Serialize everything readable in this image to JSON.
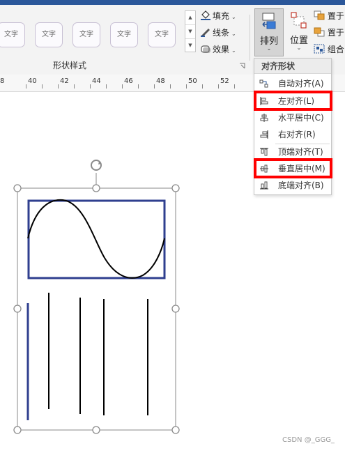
{
  "ribbon": {
    "gallery": {
      "swatch_labels": [
        "文字",
        "文字",
        "文字",
        "文字",
        "文字"
      ],
      "scroll_symbols": [
        "▲",
        "▼",
        "▼"
      ]
    },
    "format_buttons": [
      {
        "label": "填充",
        "icon": "fill-bucket-icon"
      },
      {
        "label": "线条",
        "icon": "pen-line-icon"
      },
      {
        "label": "效果",
        "icon": "effects-icon"
      }
    ],
    "group_label": "形状样式",
    "dropdown_mark": "⌄",
    "arrange": {
      "label": "排列",
      "icon": "arrange-icon"
    },
    "position": {
      "label": "位置",
      "icon": "position-icon"
    },
    "side_buttons": [
      {
        "label": "置于",
        "icon": "bring-front-icon"
      },
      {
        "label": "置于",
        "icon": "send-back-icon"
      },
      {
        "label": "组合",
        "icon": "group-icon"
      }
    ]
  },
  "ruler": {
    "numbers": [
      "8",
      "40",
      "42",
      "44",
      "46",
      "48",
      "50",
      "52"
    ]
  },
  "menu": {
    "title": "对齐形状",
    "items": [
      {
        "label": "自动对齐(A)",
        "icon": "auto-align-icon",
        "highlighted": false
      },
      {
        "label": "左对齐(L)",
        "icon": "align-left-icon",
        "highlighted": true
      },
      {
        "label": "水平居中(C)",
        "icon": "align-center-icon",
        "highlighted": false
      },
      {
        "label": "右对齐(R)",
        "icon": "align-right-icon",
        "highlighted": false
      },
      {
        "label": "顶端对齐(T)",
        "icon": "align-top-icon",
        "highlighted": false
      },
      {
        "label": "垂直居中(M)",
        "icon": "align-middle-icon",
        "highlighted": true
      },
      {
        "label": "底端对齐(B)",
        "icon": "align-bottom-icon",
        "highlighted": false
      }
    ]
  },
  "canvas": {
    "selection_color": "#8a8a8a",
    "rect_color": "#2f3f8f",
    "line_color": "#000000"
  },
  "watermark": "CSDN @_GGG_",
  "colors": {
    "title_bar": "#2b579a",
    "highlight_border": "#ff0000"
  }
}
